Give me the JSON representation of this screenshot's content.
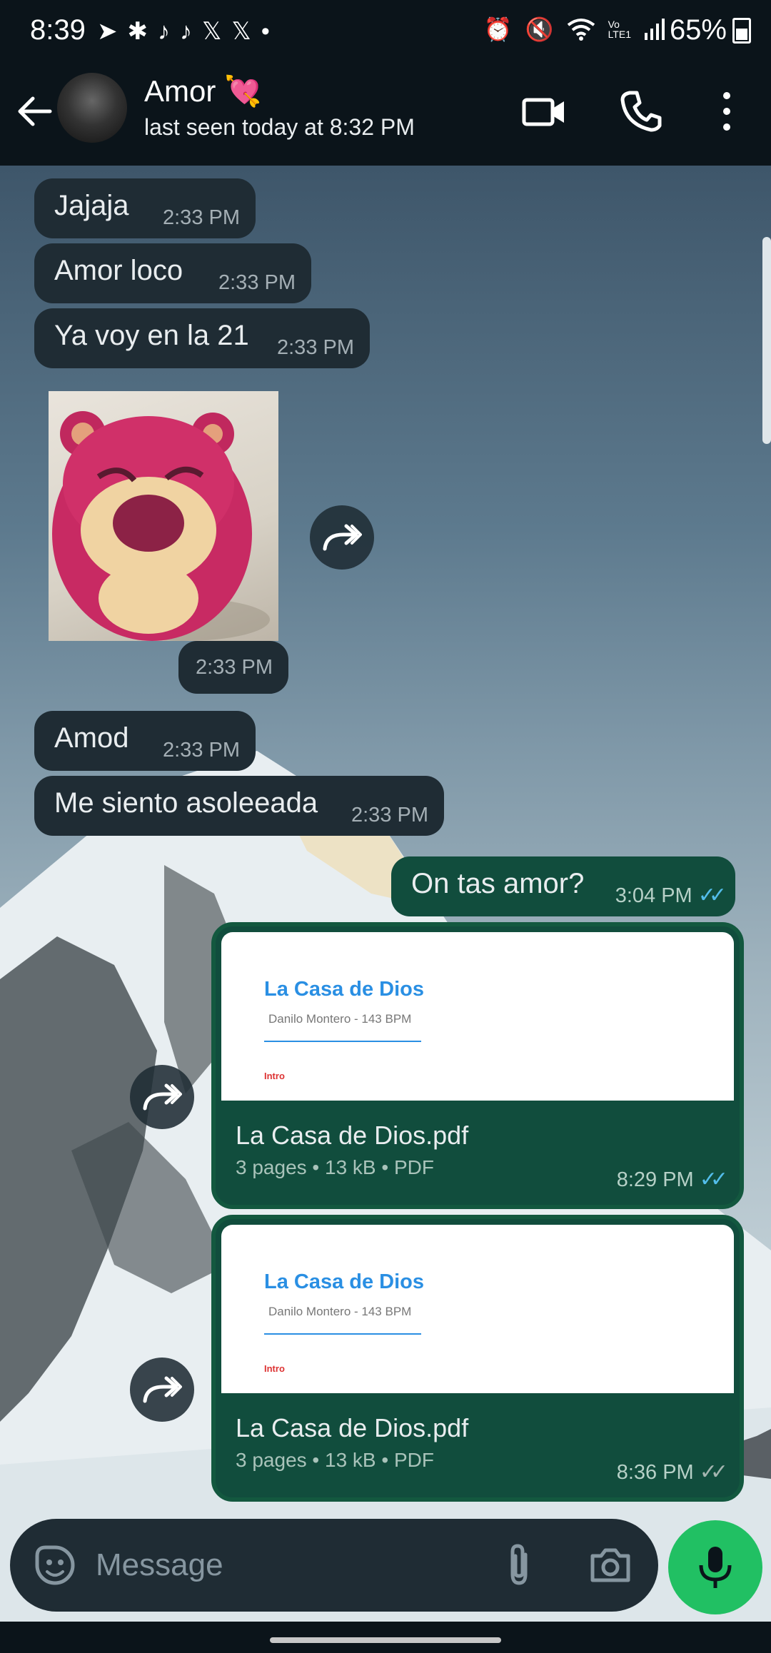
{
  "status_bar": {
    "time": "8:39",
    "battery": "65%",
    "left_icons": [
      "telegram-icon",
      "slack-icon",
      "tiktok-icon",
      "tiktok-icon",
      "x-icon",
      "x-icon",
      "dot-icon"
    ],
    "right_icons": [
      "alarm-icon",
      "mute-icon",
      "wifi-icon",
      "volte-icon",
      "signal-icon"
    ]
  },
  "header": {
    "contact_name": "Amor 💘",
    "last_seen": "last seen today at 8:32 PM"
  },
  "messages": [
    {
      "dir": "in",
      "text": "Jajaja",
      "time": "2:33 PM"
    },
    {
      "dir": "in",
      "text": "Amor loco",
      "time": "2:33 PM"
    },
    {
      "dir": "in",
      "text": "Ya voy en la 21",
      "time": "2:33 PM"
    },
    {
      "dir": "in",
      "type": "sticker",
      "time": "2:33 PM"
    },
    {
      "dir": "in",
      "text": "Amod",
      "time": "2:33 PM"
    },
    {
      "dir": "in",
      "text": "Me siento asoleeada",
      "time": "2:33 PM"
    },
    {
      "dir": "out",
      "text": "On tas amor?",
      "time": "3:04 PM",
      "status": "read"
    }
  ],
  "documents": [
    {
      "preview_title": "La Casa de Dios",
      "preview_subtitle": "Danilo Montero - 143 BPM",
      "preview_section": "Intro",
      "file_name": "La Casa de Dios.pdf",
      "meta": "3 pages • 13 kB • PDF",
      "time": "8:29 PM",
      "status": "read"
    },
    {
      "preview_title": "La Casa de Dios",
      "preview_subtitle": "Danilo Montero - 143 BPM",
      "preview_section": "Intro",
      "file_name": "La Casa de Dios.pdf",
      "meta": "3 pages • 13 kB • PDF",
      "time": "8:36 PM",
      "status": "delivered"
    }
  ],
  "input": {
    "placeholder": "Message"
  },
  "colors": {
    "incoming_bubble": "#1f2c34",
    "outgoing_bubble": "#114d3d",
    "mic_button": "#21c063",
    "read_ticks": "#53bdeb"
  }
}
